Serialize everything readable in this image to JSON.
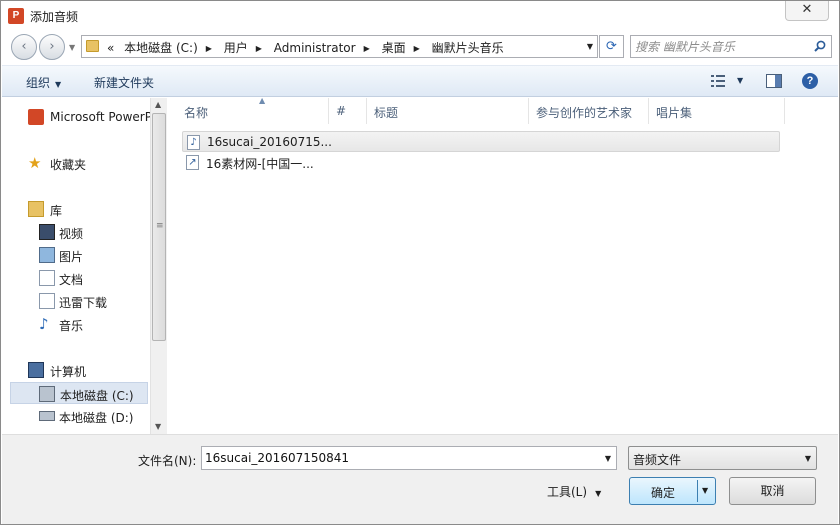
{
  "window": {
    "title": "添加音频",
    "app_icon_letter": "P",
    "close_glyph": "✕"
  },
  "nav": {
    "back_glyph": "‹",
    "forward_glyph": "›",
    "breadcrumb_overflow": "«",
    "breadcrumbs": [
      "本地磁盘 (C:)",
      "用户",
      "Administrator",
      "桌面",
      "幽默片头音乐"
    ],
    "refresh_glyph": "⟳",
    "search_placeholder": "搜索 幽默片头音乐"
  },
  "toolbar": {
    "organize_label": "组织",
    "new_folder_label": "新建文件夹"
  },
  "sidebar": {
    "items": [
      {
        "label": "Microsoft PowerP",
        "icon": "powerpoint-icon"
      },
      {
        "label": "收藏夹",
        "icon": "favorites-star-icon"
      },
      {
        "label": "库",
        "icon": "library-icon"
      },
      {
        "label": "视频",
        "icon": "video-icon"
      },
      {
        "label": "图片",
        "icon": "picture-icon"
      },
      {
        "label": "文档",
        "icon": "document-icon"
      },
      {
        "label": "迅雷下载",
        "icon": "download-icon"
      },
      {
        "label": "音乐",
        "icon": "music-icon"
      },
      {
        "label": "计算机",
        "icon": "computer-icon"
      },
      {
        "label": "本地磁盘 (C:)",
        "icon": "drive-c-icon",
        "selected": true
      },
      {
        "label": "本地磁盘 (D:)",
        "icon": "drive-d-icon"
      }
    ]
  },
  "columns": [
    "名称",
    "#",
    "标题",
    "参与创作的艺术家",
    "唱片集"
  ],
  "files": [
    {
      "name": "16sucai_20160715...",
      "icon": "audio-file-icon",
      "selected": true
    },
    {
      "name": "16素材网-[中国一...",
      "icon": "shortcut-file-icon",
      "selected": false
    }
  ],
  "bottom": {
    "filename_label": "文件名(N):",
    "filename_value": "16sucai_201607150841",
    "filetype_value": "音频文件",
    "tools_label": "工具(L)",
    "ok_label": "确定",
    "cancel_label": "取消"
  },
  "colors": {
    "accent": "#3c7fb1",
    "selection": "#dde6f2",
    "toolbar_text": "#1e395b",
    "powerpoint": "#d24726"
  }
}
